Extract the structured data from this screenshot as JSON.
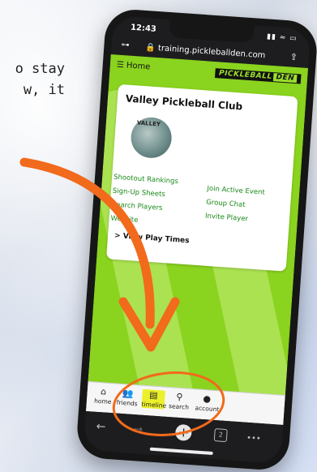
{
  "caption": {
    "line1": "o stay",
    "line2": "w, it"
  },
  "status": {
    "time": "12:43",
    "icons": "▮▮ ≈ ▭"
  },
  "browser": {
    "lock": "🔒",
    "url": "training.pickleballden.com",
    "key_icon": "key-icon",
    "share_icon": "share-icon"
  },
  "header": {
    "menu": "☰ Home",
    "brand_main": "PICKLEBALL",
    "brand_den": "DEN"
  },
  "club": {
    "title": "Valley Pickleball Club",
    "logo_text": "VALLEY",
    "links_left": [
      "Shootout Rankings",
      "Sign-Up Sheets",
      "Search Players",
      "Website"
    ],
    "links_right": [
      "Join Active Event",
      "Group Chat",
      "Invite Player"
    ],
    "playtimes": "> View Play Times"
  },
  "tabs": [
    {
      "label": "home",
      "icon": "home-icon"
    },
    {
      "label": "friends",
      "icon": "friends-icon"
    },
    {
      "label": "timeline",
      "icon": "timeline-icon"
    },
    {
      "label": "search",
      "icon": "search-icon"
    },
    {
      "label": "account",
      "icon": "account-icon"
    }
  ],
  "nav": {
    "back": "←",
    "forward": "→",
    "new_tab": "+",
    "tab_count": "2",
    "more": "•••"
  },
  "colors": {
    "page_green": "#8ad31f",
    "arrow": "#f26a1b",
    "timeline_highlight": "#ecf02a"
  }
}
